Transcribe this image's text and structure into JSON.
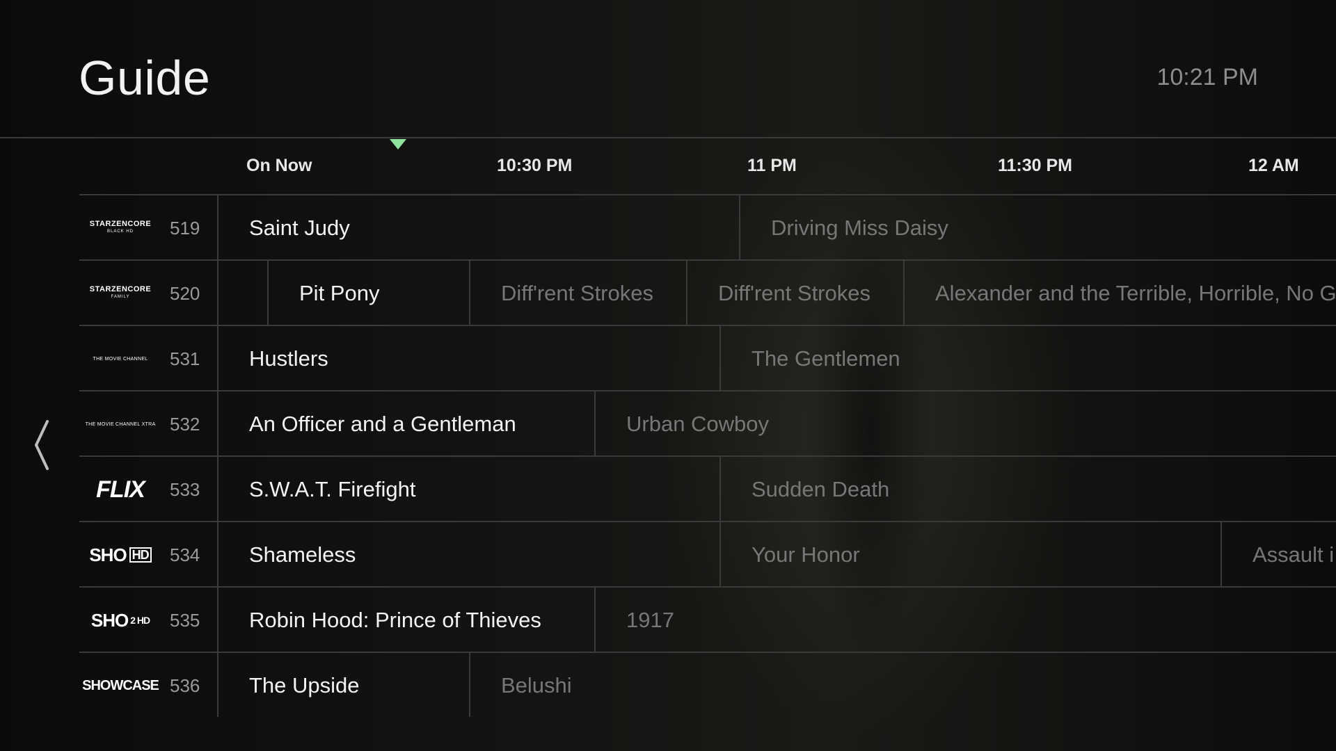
{
  "header": {
    "title": "Guide",
    "clock": "10:21 PM"
  },
  "timeline": [
    "On Now",
    "10:30 PM",
    "11 PM",
    "11:30 PM",
    "12 AM"
  ],
  "channels": [
    {
      "logo": "STARZENCORE",
      "logo_sub": "BLACK HD",
      "number": "519",
      "programs": [
        "Saint Judy",
        "Driving Miss Daisy"
      ]
    },
    {
      "logo": "STARZENCORE",
      "logo_sub": "FAMILY",
      "number": "520",
      "programs": [
        "Pit Pony",
        "Diff'rent Strokes",
        "Diff'rent Strokes",
        "Alexander and the Terrible, Horrible, No G"
      ]
    },
    {
      "logo": "THE MOVIE CHANNEL",
      "number": "531",
      "programs": [
        "Hustlers",
        "The Gentlemen"
      ]
    },
    {
      "logo": "THE MOVIE CHANNEL XTRA",
      "number": "532",
      "programs": [
        "An Officer and a Gentleman",
        "Urban Cowboy"
      ]
    },
    {
      "logo": "FLIX",
      "number": "533",
      "programs": [
        "S.W.A.T. Firefight",
        "Sudden Death"
      ]
    },
    {
      "logo": "SHO",
      "logo_sub": "HD",
      "number": "534",
      "programs": [
        "Shameless",
        "Your Honor",
        "Assault i"
      ]
    },
    {
      "logo": "SHO",
      "logo_sub": "2 HD",
      "number": "535",
      "programs": [
        "Robin Hood: Prince of Thieves",
        "1917"
      ]
    },
    {
      "logo": "SHOWCASE",
      "number": "536",
      "programs": [
        "The Upside",
        "Belushi"
      ]
    }
  ]
}
